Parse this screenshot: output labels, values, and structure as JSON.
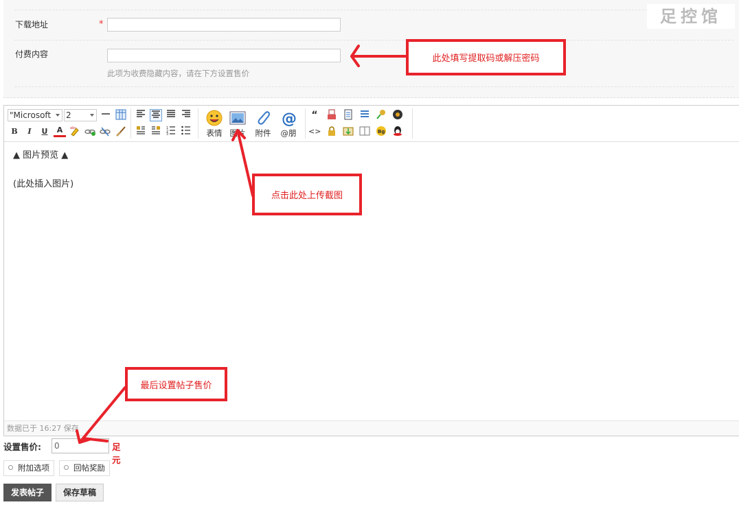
{
  "form": {
    "download_label": "下载地址",
    "required_mark": "*",
    "download_value": "",
    "paid_label": "付费内容",
    "paid_value": "",
    "paid_hint": "此项为收费隐藏内容，请在下方设置售价"
  },
  "watermark": "足控馆",
  "toolbar": {
    "font_family": "\"Microsoft",
    "font_size": "2",
    "bold": "B",
    "italic": "I",
    "underline": "U",
    "fore_color": "A",
    "emoji_label": "表情",
    "image_label": "图片",
    "attach_label": "附件",
    "at_label": "@朋",
    "quote": "“",
    "code": "<>"
  },
  "editor": {
    "preview_heading": "▲ 图片预览 ▲",
    "insert_placeholder": "(此处插入图片)",
    "status": "数据已于 16:27 保存"
  },
  "price": {
    "label": "设置售价:",
    "value": "0",
    "unit": "足元"
  },
  "options": {
    "extra": "附加选项",
    "reply_reward": "回帖奖励"
  },
  "actions": {
    "submit": "发表帖子",
    "save_draft": "保存草稿"
  },
  "annotations": {
    "code_tip": "此处填写提取码或解压密码",
    "upload_tip": "点击此处上传截图",
    "price_tip": "最后设置帖子售价"
  },
  "colors": {
    "annotation_red": "#e8232b",
    "price_unit": "#e02020",
    "submit_bg": "#555555"
  }
}
